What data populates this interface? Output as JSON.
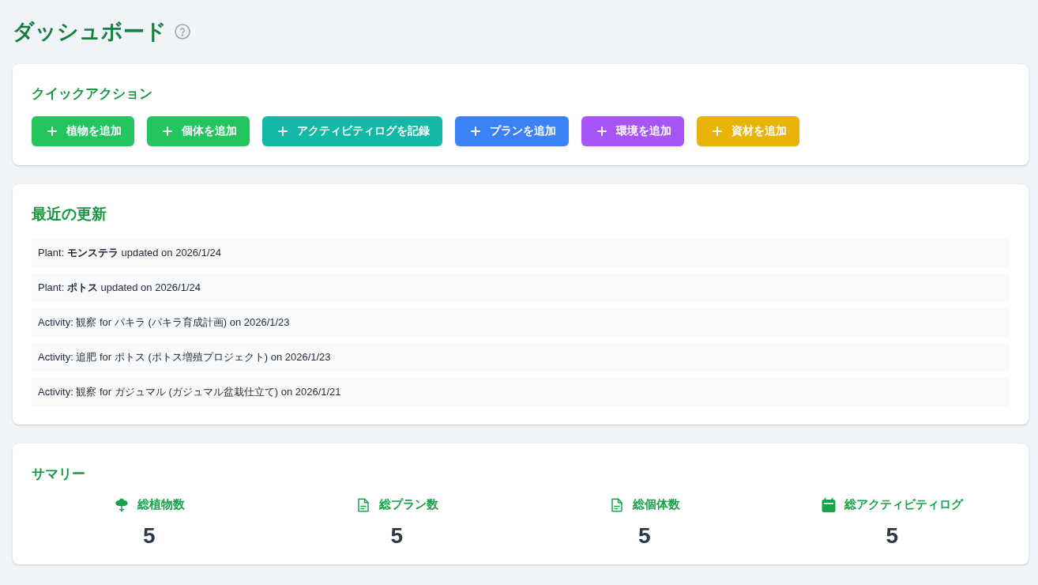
{
  "page": {
    "title": "ダッシュボード"
  },
  "quick_actions": {
    "heading": "クイックアクション",
    "buttons": [
      {
        "label": "植物を追加",
        "color": "#22c55e"
      },
      {
        "label": "個体を追加",
        "color": "#22c55e"
      },
      {
        "label": "アクティビティログを記録",
        "color": "#14b8a6"
      },
      {
        "label": "プランを追加",
        "color": "#3b82f6"
      },
      {
        "label": "環境を追加",
        "color": "#a855f7"
      },
      {
        "label": "資材を追加",
        "color": "#eab308"
      }
    ]
  },
  "recent_updates": {
    "heading": "最近の更新",
    "items": [
      "Plant: **モンステラ** updated on 2026/1/24",
      "Plant: **ポトス** updated on 2026/1/24",
      "Activity: 観察 for パキラ (パキラ育成計画) on 2026/1/23",
      "Activity: 追肥 for ポトス (ポトス増殖プロジェクト) on 2026/1/23",
      "Activity: 観察 for ガジュマル (ガジュマル盆栽仕立て) on 2026/1/21"
    ]
  },
  "summary": {
    "heading": "サマリー",
    "stats": [
      {
        "label": "総植物数",
        "value": "5"
      },
      {
        "label": "総プラン数",
        "value": "5"
      },
      {
        "label": "総個体数",
        "value": "5"
      },
      {
        "label": "総アクティビティログ",
        "value": "5"
      }
    ]
  }
}
